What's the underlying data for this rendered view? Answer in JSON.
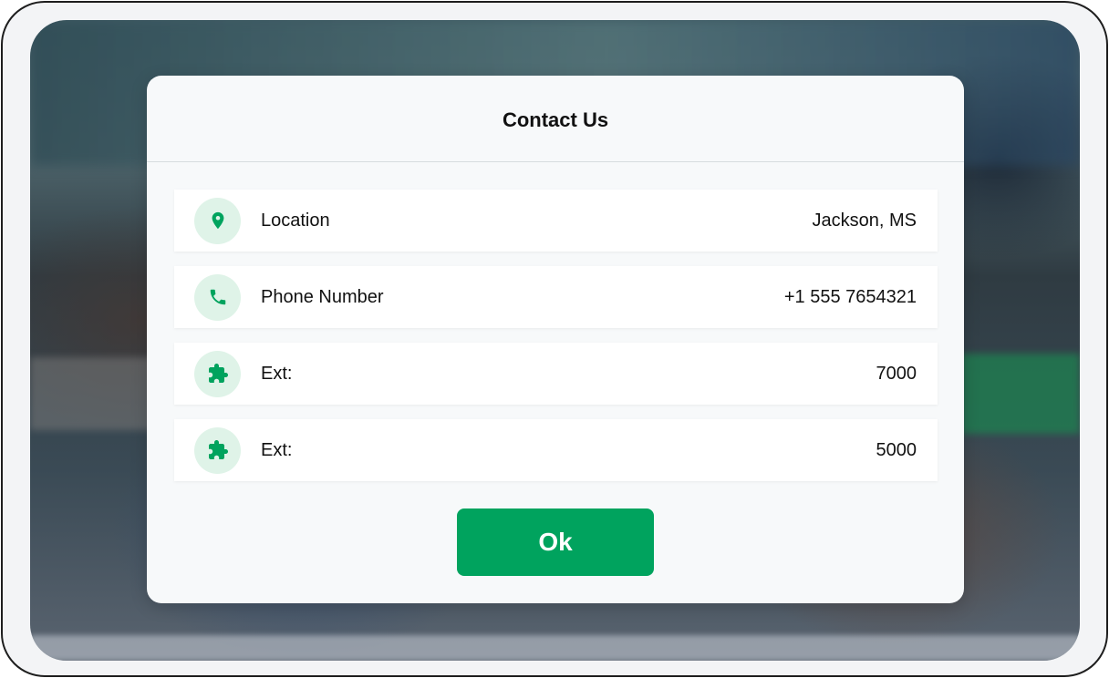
{
  "dialog": {
    "title": "Contact Us",
    "rows": [
      {
        "icon": "location-pin-icon",
        "label": "Location",
        "value": "Jackson, MS"
      },
      {
        "icon": "phone-icon",
        "label": "Phone Number",
        "value": "+1 555 7654321"
      },
      {
        "icon": "puzzle-piece-icon",
        "label": "Ext:",
        "value": "7000"
      },
      {
        "icon": "puzzle-piece-icon",
        "label": "Ext:",
        "value": "5000"
      }
    ],
    "ok_label": "Ok"
  },
  "colors": {
    "accent": "#00A35E",
    "icon_background": "#DFF3E8",
    "modal_background": "#F7F9FA"
  }
}
